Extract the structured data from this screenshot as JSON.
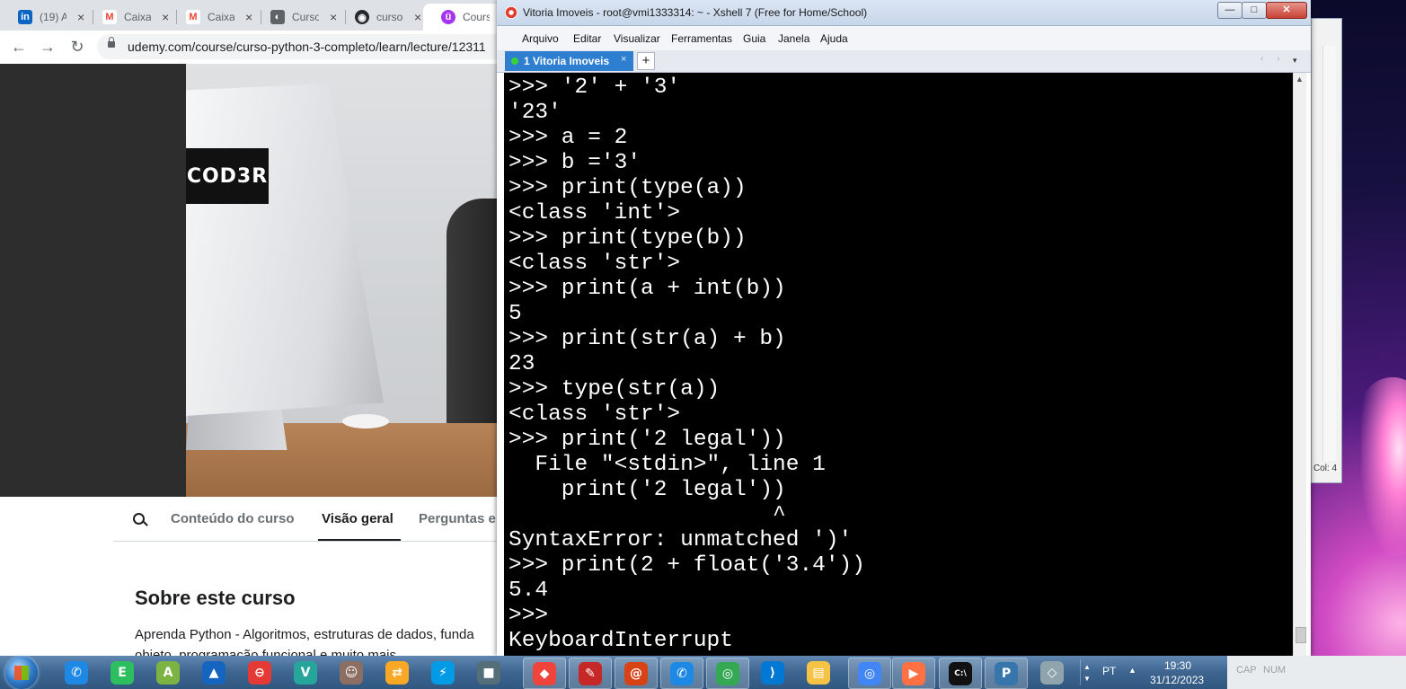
{
  "browser": {
    "tabs": [
      {
        "title": "(19) A",
        "icon": "linkedin-icon",
        "color": "#0a66c2",
        "glyph": "in"
      },
      {
        "title": "Caixa",
        "icon": "gmail-icon",
        "color": "#ea4335",
        "glyph": "M"
      },
      {
        "title": "Caixa",
        "icon": "gmail-icon",
        "color": "#ea4335",
        "glyph": "M"
      },
      {
        "title": "Curso",
        "icon": "globe-icon",
        "color": "#5f6368",
        "glyph": "◐"
      },
      {
        "title": "curso",
        "icon": "github-icon",
        "color": "#24292f",
        "glyph": "◉"
      },
      {
        "title": "Cours",
        "icon": "udemy-icon",
        "color": "#a435f0",
        "glyph": "ü"
      }
    ],
    "close_glyph": "×",
    "url": "udemy.com/course/curso-python-3-completo/learn/lecture/12311",
    "back": "←",
    "forward": "→",
    "reload": "↻"
  },
  "course": {
    "video_logo": "COD3R",
    "tabs": [
      "Conteúdo do curso",
      "Visão geral",
      "Perguntas e"
    ],
    "active_tab": "Visão geral",
    "about_title": "Sobre este curso",
    "about_text": "Aprenda Python - Algoritmos, estruturas de dados, funda",
    "about_text2": "objeto, programação funcional e muito mais"
  },
  "xshell": {
    "title": "Vitoria Imoveis - root@vmi1333314: ~ - Xshell 7 (Free for Home/School)",
    "menu": [
      "Arquivo",
      "Editar",
      "Visualizar",
      "Ferramentas",
      "Guia",
      "Janela",
      "Ajuda"
    ],
    "tab_label": "1 Vitoria Imoveis",
    "tab_close": "×",
    "new_tab": "+",
    "tab_nav": "‹ ›",
    "tab_dropdown": "▾",
    "window_buttons": {
      "minimize": "—",
      "maximize": "□",
      "close": "✕"
    },
    "terminal_lines": [
      ">>> '2' + '3'",
      "'23'",
      ">>> a = 2",
      ">>> b ='3'",
      ">>> print(type(a))",
      "<class 'int'>",
      ">>> print(type(b))",
      "<class 'str'>",
      ">>> print(a + int(b))",
      "5",
      ">>> print(str(a) + b)",
      "23",
      ">>> type(str(a))",
      "<class 'str'>",
      ">>> print('2 legal'))",
      "  File \"<stdin>\", line 1",
      "    print('2 legal'))",
      "                    ^",
      "SyntaxError: unmatched ')'",
      ">>> print(2 + float('3.4'))",
      "5.4",
      ">>>",
      "KeyboardInterrupt"
    ],
    "scroll_up": "▲"
  },
  "background_window": {
    "status_text": "Col: 4"
  },
  "taskbar": {
    "apps": [
      {
        "name": "phone-icon",
        "color": "#1e88e5",
        "glyph": "✆",
        "active": false
      },
      {
        "name": "evernote-icon",
        "color": "#2dbe60",
        "glyph": "E",
        "active": false
      },
      {
        "name": "android-icon",
        "color": "#7cb342",
        "glyph": "A",
        "active": false
      },
      {
        "name": "shark-icon",
        "color": "#1565c0",
        "glyph": "▲",
        "active": false
      },
      {
        "name": "app-red-icon",
        "color": "#e53935",
        "glyph": "⊖",
        "active": false
      },
      {
        "name": "vite-icon",
        "color": "#26a69a",
        "glyph": "V",
        "active": false
      },
      {
        "name": "monkey-icon",
        "color": "#8d6e63",
        "glyph": "☺",
        "active": false
      },
      {
        "name": "network-icon",
        "color": "#f9a825",
        "glyph": "⇄",
        "active": false
      },
      {
        "name": "bolt-icon",
        "color": "#039be5",
        "glyph": "⚡",
        "active": false
      },
      {
        "name": "lock-app-icon",
        "color": "#546e7a",
        "glyph": "■",
        "active": false
      },
      {
        "name": "anydesk-icon",
        "color": "#ef443b",
        "glyph": "◆",
        "active": true
      },
      {
        "name": "paint-icon",
        "color": "#c62828",
        "glyph": "✎",
        "active": true
      },
      {
        "name": "xshell-icon",
        "color": "#d84315",
        "glyph": "@",
        "active": true
      },
      {
        "name": "phone2-icon",
        "color": "#1e88e5",
        "glyph": "✆",
        "active": true
      },
      {
        "name": "chrome-icon",
        "color": "#34a853",
        "glyph": "◎",
        "active": true
      },
      {
        "name": "vscode-icon",
        "color": "#0078d4",
        "glyph": "⟩",
        "active": false
      },
      {
        "name": "explorer-icon",
        "color": "#f6c344",
        "glyph": "▤",
        "active": false
      },
      {
        "name": "chrome-profile-icon",
        "color": "#4285f4",
        "glyph": "◎",
        "active": true
      },
      {
        "name": "media-icon",
        "color": "#ff7043",
        "glyph": "▶",
        "active": true
      },
      {
        "name": "cmd-icon",
        "color": "#111111",
        "glyph": "C:\\",
        "active": true
      },
      {
        "name": "python-icon",
        "color": "#3776ab",
        "glyph": "P",
        "active": true
      },
      {
        "name": "tool-icon",
        "color": "#90a4ae",
        "glyph": "◇",
        "active": false
      }
    ],
    "language": "PT",
    "tray_up": "▲",
    "time": "19:30",
    "date": "31/12/2023",
    "cap": "CAP",
    "num": "NUM"
  }
}
